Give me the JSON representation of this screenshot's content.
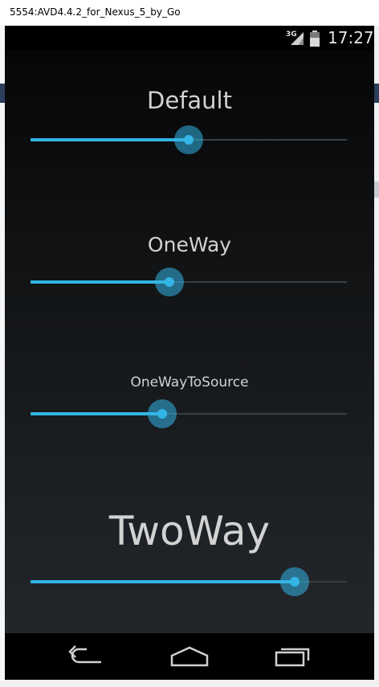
{
  "window": {
    "title": "5554:AVD4.4.2_for_Nexus_5_by_Go"
  },
  "status_bar": {
    "network": "3G",
    "time": "17:27"
  },
  "accent_color": "#33b5e5",
  "sliders": [
    {
      "label": "Default",
      "value": 0.5
    },
    {
      "label": "OneWay",
      "value": 0.44
    },
    {
      "label": "OneWayToSource",
      "value": 0.415
    },
    {
      "label": "TwoWay",
      "value": 0.835
    }
  ],
  "nav_bar": {
    "back": "back-icon",
    "home": "home-icon",
    "recents": "recents-icon"
  }
}
